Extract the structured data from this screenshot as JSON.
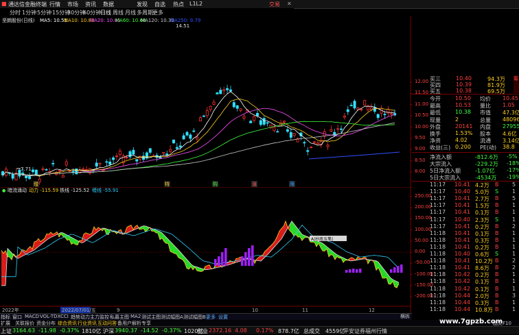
{
  "menu": {
    "app_title": "通达信金融终端",
    "items": [
      "行情",
      "市场",
      "资讯",
      "数据",
      "发现",
      "自选",
      "热点",
      "L1L2"
    ],
    "trade_label": "交易"
  },
  "toolbar": {
    "periods": [
      "分时",
      "1分钟",
      "5分钟",
      "15分钟",
      "30分钟",
      "60分钟",
      "日线",
      "周线",
      "月线",
      "多周期",
      "更多"
    ]
  },
  "kline": {
    "stock_name": "坚朗股份(日线)",
    "ma_labels": [
      {
        "text": "MA5: 10.51",
        "color": "#ffffff"
      },
      {
        "text": "MA10: 10.83",
        "color": "#ffd020"
      },
      {
        "text": "MA20: 10.85",
        "color": "#ff50ff"
      },
      {
        "text": "MA60: 10.68",
        "color": "#40ff40"
      },
      {
        "text": "MA120: 10.39",
        "color": "#c8c8c8"
      },
      {
        "text": "MA250: 9.79",
        "color": "#3050ff"
      }
    ],
    "high_label": "14.51",
    "low_label": "7.71",
    "price_ticks": [
      "12.00",
      "11.50",
      "11.00",
      "10.50",
      "10.00",
      "9.50",
      "9.00",
      "8.50",
      "8.00"
    ],
    "event_markers": [
      {
        "text": "增",
        "color": "#ffd020"
      },
      {
        "text": "特",
        "color": "#ffd020"
      },
      {
        "text": "购",
        "color": "#40ff40"
      },
      {
        "text": "涨",
        "color": "#ff6060"
      },
      {
        "text": "限",
        "color": "#30a0ff"
      }
    ]
  },
  "macd": {
    "title": "暗流涌动",
    "lines": [
      {
        "text": "动力 -115.59",
        "color": "#ffd020"
      },
      {
        "text": "铁线 -125.52",
        "color": "#e0e0e0"
      },
      {
        "text": "缠线 -55.91",
        "color": "#30d0ff"
      }
    ],
    "ticks": [
      "250.00",
      "200.00",
      "150.00",
      "100.00",
      "50.00",
      "0.00",
      "-50.00",
      "-100.00",
      "-150.00",
      "-200.00"
    ],
    "tooltip": "A|抄底五笔|"
  },
  "dates": {
    "items": [
      "2022年",
      "2022/07/01/五",
      "9",
      "10",
      "11",
      "12"
    ]
  },
  "quote": {
    "top_rows": [
      {
        "label": "买三",
        "price": "10.40",
        "vol": "94.3万"
      },
      {
        "label": "买四",
        "price": "10.39",
        "vol": "81.9万"
      },
      {
        "label": "买五",
        "price": "10.38",
        "vol": "69.5万"
      }
    ],
    "stats": [
      {
        "l1": "今开",
        "v1": "10.50",
        "l2": "均价",
        "v2": "10.45"
      },
      {
        "l1": "最高",
        "v1": "10.53",
        "l2": "量比",
        "v2": "1.05"
      },
      {
        "l1": "最低",
        "v1": "10.38",
        "l2": "市值",
        "v2": "47.3亿"
      },
      {
        "l1": "现量",
        "v1": "2",
        "l2": "总量",
        "v2": "48096"
      },
      {
        "l1": "外盘",
        "v1": "20141",
        "l2": "内盘",
        "v2": "27955"
      },
      {
        "l1": "换手",
        "v1": "1.53%",
        "l2": "股本",
        "v2": "4.6亿"
      },
      {
        "l1": "净资",
        "v1": "4.02",
        "l2": "流通",
        "v2": "3.14亿"
      },
      {
        "l1": "收益(三)",
        "v1": "0.200",
        "l2": "PE(动)",
        "v2": "38.8"
      }
    ],
    "flows": [
      {
        "label": "净流入额",
        "value": "-812.6万",
        "pct": "-5%"
      },
      {
        "label": "大宗流入",
        "value": "-229.2万",
        "pct": "-18%"
      },
      {
        "label": "5日净流入额",
        "value": "-1.07亿",
        "pct": "-17%"
      },
      {
        "label": "5日大宗流入",
        "value": "-4534万",
        "pct": "-19%"
      }
    ],
    "ticks": [
      {
        "time": "11:17",
        "price": "10.41",
        "vol": "4.2万",
        "bs": "B",
        "n": "5"
      },
      {
        "time": "11:17",
        "price": "10.40",
        "vol": "5.0万",
        "bs": "S",
        "n": "1"
      },
      {
        "time": "11:17",
        "price": "10.41",
        "vol": "2.7万",
        "bs": "B",
        "n": "5"
      },
      {
        "time": "11:17",
        "price": "10.41",
        "vol": "1.5万",
        "bs": "B",
        "n": "1"
      },
      {
        "time": "11:17",
        "price": "10.41",
        "vol": "0.1万",
        "bs": "B",
        "n": "1"
      },
      {
        "time": "11:17",
        "price": "10.40",
        "vol": "2.3万",
        "bs": "S",
        "n": "1"
      },
      {
        "time": "11:17",
        "price": "10.41",
        "vol": "0.2万",
        "bs": "B",
        "n": "2"
      },
      {
        "time": "11:18",
        "price": "10.41",
        "vol": "0.1万",
        "bs": "B",
        "n": "1"
      },
      {
        "time": "11:18",
        "price": "10.41",
        "vol": "0.3万",
        "bs": "B",
        "n": "1"
      },
      {
        "time": "11:18",
        "price": "10.41",
        "vol": "0.2万",
        "bs": "B",
        "n": "1"
      },
      {
        "time": "11:18",
        "price": "10.40",
        "vol": "0.6万",
        "bs": "S",
        "n": "1"
      },
      {
        "time": "11:18",
        "price": "10.41",
        "vol": "10.2万",
        "bs": "B",
        "n": "2"
      },
      {
        "time": "11:18",
        "price": "10.41",
        "vol": "8.6万",
        "bs": "B",
        "n": "2"
      },
      {
        "time": "11:18",
        "price": "10.42",
        "vol": "0.2万",
        "bs": "B",
        "n": "1"
      },
      {
        "time": "11:18",
        "price": "10.42",
        "vol": "0.1万",
        "bs": "B",
        "n": "1"
      },
      {
        "time": "11:18",
        "price": "10.42",
        "vol": "0.1万",
        "bs": "B",
        "n": "1"
      },
      {
        "time": "11:18",
        "price": "10.44",
        "vol": "2.0万",
        "bs": "B",
        "n": "3"
      },
      {
        "time": "11:18",
        "price": "10.44",
        "vol": "0.3万",
        "bs": "B",
        "n": "1"
      },
      {
        "time": "11:18",
        "price": "10.44",
        "vol": "10.8万",
        "bs": "B",
        "n": "1"
      }
    ],
    "side_tab": "筹"
  },
  "bottom_tabs": [
    "指标",
    "窗口",
    "MACD",
    "VOL-TDX",
    "CCI",
    "趋势动力",
    "主力监控",
    "私募主图",
    "MA2",
    "测试主图",
    "测试幅图A",
    "测试幅图B",
    "更多",
    "设置"
  ],
  "view_tab": "横拆",
  "ext_tabs": [
    "扩展",
    "关联报价",
    "资金分布",
    "综合资讯",
    "行业资讯",
    "互动问答",
    "备用户解析专享"
  ],
  "ext_right": "图文F10",
  "status": {
    "items": [
      {
        "name": "上证",
        "value": "3164.63",
        "chg": "-11.98",
        "pct": "-0.37%",
        "amt": "1810亿"
      },
      {
        "name": "沪深",
        "value": "3940.37",
        "chg": "-14.52",
        "pct": "-0.37%",
        "amt": "1020亿"
      },
      {
        "name": "创业",
        "value": "2372.16",
        "chg": "4.08",
        "pct": "0.17%",
        "amt": "878.7亿"
      }
    ],
    "total": "总成交",
    "total_value": "4559亿",
    "broker": "平安证券福州行情"
  },
  "watermark": "www.7gpzb.com",
  "colors": {
    "up": "#ff4040",
    "down": "#40ff40",
    "text": "#c8c8c8",
    "bg": "#000000"
  }
}
